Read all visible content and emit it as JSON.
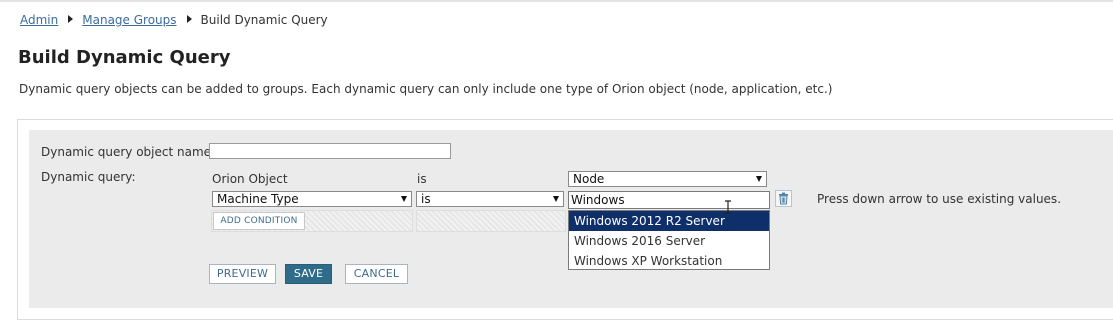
{
  "breadcrumb": {
    "items": [
      "Admin",
      "Manage Groups"
    ],
    "current": "Build Dynamic Query"
  },
  "page": {
    "title": "Build Dynamic Query",
    "description": "Dynamic query objects can be added to groups. Each dynamic query can only include one type of Orion object (node, application, etc.)"
  },
  "form": {
    "name_label": "Dynamic query object name:",
    "name_value": "",
    "query_label": "Dynamic query:",
    "orion_object_label": "Orion Object",
    "is_label": "is",
    "object_type": "Node",
    "condition": {
      "field": "Machine Type",
      "operator": "is",
      "value": "Windows"
    },
    "suggestions": [
      "Windows 2012 R2 Server",
      "Windows 2016 Server",
      "Windows XP Workstation"
    ],
    "selected_suggestion_index": 0,
    "add_condition_label": "ADD CONDITION",
    "hint": "Press down arrow to use existing values."
  },
  "buttons": {
    "preview": "PREVIEW",
    "save": "SAVE",
    "cancel": "CANCEL"
  },
  "colors": {
    "link": "#3b6c9c",
    "primary_button": "#2f6c89",
    "selected_item": "#0f2f6b",
    "panel_bg": "#ebebeb"
  }
}
